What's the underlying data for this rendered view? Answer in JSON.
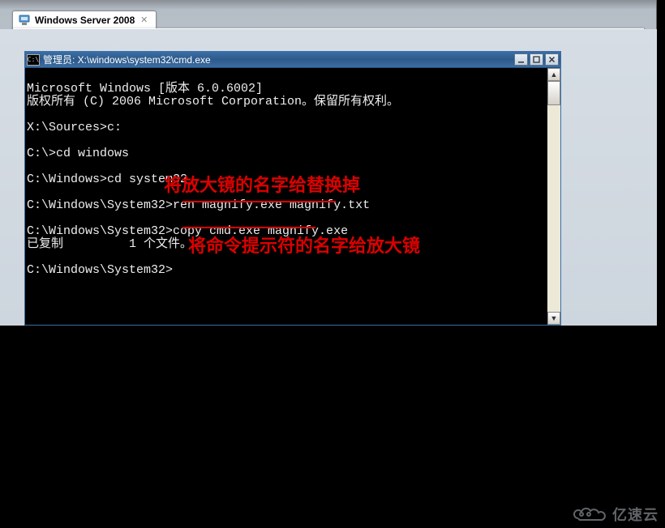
{
  "tab": {
    "label": "Windows Server 2008"
  },
  "cmd_window": {
    "title_prefix": "管理员: ",
    "title_path": "X:\\windows\\system32\\cmd.exe"
  },
  "terminal_lines": {
    "l1": "Microsoft Windows [版本 6.0.6002]",
    "l2": "版权所有 (C) 2006 Microsoft Corporation。保留所有权利。",
    "l3": "",
    "l4": "X:\\Sources>c:",
    "l5": "",
    "l6": "C:\\>cd windows",
    "l7": "",
    "l8": "C:\\Windows>cd system32",
    "l9": "",
    "l10a": "C:\\Windows\\System32>",
    "l10b": "ren magnify.exe magnify.txt",
    "l11": "",
    "l12a": "C:\\Windows\\System32>",
    "l12b": "copy cmd.exe magnify.exe",
    "l13": "已复制         1 个文件。",
    "l14": "",
    "l15": "C:\\Windows\\System32>"
  },
  "annotations": {
    "a1": "将放大镜的名字给替换掉",
    "a2": "将命令提示符的名字给放大镜"
  },
  "watermark": "亿速云"
}
